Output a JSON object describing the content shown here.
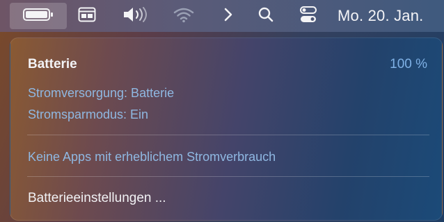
{
  "menubar": {
    "clock": "Mo. 20. Jan.",
    "icons": {
      "battery": "battery-full-icon",
      "menu_extra": "window-menu-icon",
      "volume": "speaker-volume-icon",
      "wifi": "wifi-icon",
      "chevron": "chevron-right-icon",
      "search": "search-icon",
      "control_center": "control-center-icon"
    }
  },
  "battery_menu": {
    "title": "Batterie",
    "percent": "100 %",
    "power_source": "Stromversorgung: Batterie",
    "low_power_mode": "Stromsparmodus: Ein",
    "apps_note": "Keine Apps mit erheblichem Stromverbrauch",
    "settings_label": "Batterieeinstellungen ..."
  },
  "colors": {
    "accent_text": "#8fb8e2",
    "percent_text": "#7fb1e6"
  }
}
